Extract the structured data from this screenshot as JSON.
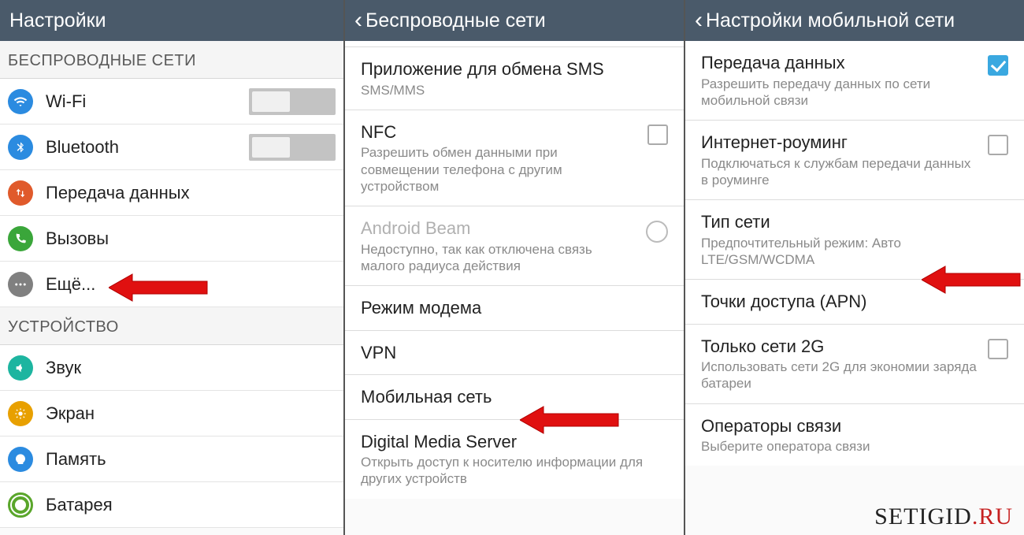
{
  "watermark": {
    "a": "SETIGID",
    "b": ".RU"
  },
  "panel1": {
    "title": "Настройки",
    "cat_wireless": "БЕСПРОВОДНЫЕ СЕТИ",
    "cat_device": "УСТРОЙСТВО",
    "wifi": "Wi-Fi",
    "bluetooth": "Bluetooth",
    "data": "Передача данных",
    "calls": "Вызовы",
    "more": "Ещё...",
    "sound": "Звук",
    "display": "Экран",
    "memory": "Память",
    "battery": "Батарея",
    "toggle_off_glyph": "O"
  },
  "panel2": {
    "title": "Беспроводные сети",
    "sms_t": "Приложение для обмена SMS",
    "sms_s": "SMS/MMS",
    "nfc_t": "NFC",
    "nfc_s": "Разрешить обмен данными при совмещении телефона с другим устройством",
    "beam_t": "Android Beam",
    "beam_s": "Недоступно, так как отключена связь малого радиуса действия",
    "tether_t": "Режим модема",
    "vpn_t": "VPN",
    "mobile_t": "Мобильная сеть",
    "dms_t": "Digital Media Server",
    "dms_s": "Открыть доступ к носителю информации для других устройств"
  },
  "panel3": {
    "title": "Настройки мобильной сети",
    "data_t": "Передача данных",
    "data_s": "Разрешить передачу данных по сети мобильной связи",
    "roam_t": "Интернет-роуминг",
    "roam_s": "Подключаться к службам передачи данных в роуминге",
    "nettype_t": "Тип сети",
    "nettype_s": "Предпочтительный режим: Авто LTE/GSM/WCDMA",
    "apn_t": "Точки доступа (APN)",
    "only2g_t": "Только сети 2G",
    "only2g_s": "Использовать сети 2G для экономии заряда батареи",
    "ops_t": "Операторы связи",
    "ops_s": "Выберите оператора связи"
  }
}
